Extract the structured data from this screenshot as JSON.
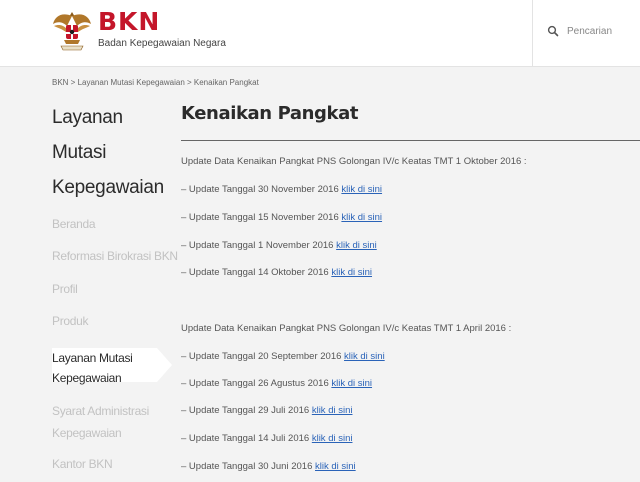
{
  "header": {
    "brand": "BKN",
    "brand_subtitle": "Badan Kepegawaian Negara",
    "search_placeholder": "Pencarian"
  },
  "breadcrumb": {
    "home": "BKN",
    "sep1": " > ",
    "section": "Layanan Mutasi Kepegawaian",
    "sep2": " > ",
    "current": "Kenaikan Pangkat"
  },
  "sidebar": {
    "title_lines": [
      "Layanan",
      "Mutasi",
      "Kepegawaian"
    ],
    "items": [
      {
        "label": "Beranda"
      },
      {
        "label": "Reformasi Birokrasi BKN"
      },
      {
        "label": "Profil"
      },
      {
        "label": "Produk"
      },
      {
        "label": "Layanan Mutasi",
        "label2": "Kepegawaian"
      },
      {
        "label": "Syarat Administrasi",
        "label2": "Kepegawaian"
      },
      {
        "label": "Kantor BKN"
      }
    ]
  },
  "main": {
    "title": "Kenaikan Pangkat",
    "sections": [
      {
        "heading": "Update Data Kenaikan Pangkat PNS Golongan IV/c Keatas  TMT 1 Oktober 2016 :",
        "updates": [
          {
            "text": "– Update Tanggal 30 November 2016 ",
            "link": "klik di sini"
          },
          {
            "text": "– Update Tanggal 15 November 2016 ",
            "link": "klik di sini"
          },
          {
            "text": "– Update Tanggal 1 November 2016 ",
            "link": "klik di sini"
          },
          {
            "text": "– Update Tanggal 14 Oktober 2016 ",
            "link": "klik di sini"
          }
        ]
      },
      {
        "heading": "Update Data Kenaikan Pangkat PNS Golongan IV/c Keatas  TMT 1 April 2016 :",
        "updates": [
          {
            "text": "– Update Tanggal 20 September 2016 ",
            "link": "klik di sini"
          },
          {
            "text": "– Update Tanggal 26 Agustus 2016 ",
            "link": "klik di sini"
          },
          {
            "text": "– Update Tanggal 29 Juli 2016 ",
            "link": "klik di sini"
          },
          {
            "text": "– Update Tanggal 14 Juli 2016 ",
            "link": "klik di sini"
          },
          {
            "text": "– Update Tanggal 30 Juni 2016 ",
            "link": "klik di sini"
          }
        ]
      }
    ]
  },
  "colors": {
    "brand_red": "#c4162a",
    "link_blue": "#2a63b8",
    "band_bg": "#f3f3f3"
  },
  "icons": {
    "logo": "garuda-emblem-icon",
    "search": "search-icon"
  }
}
